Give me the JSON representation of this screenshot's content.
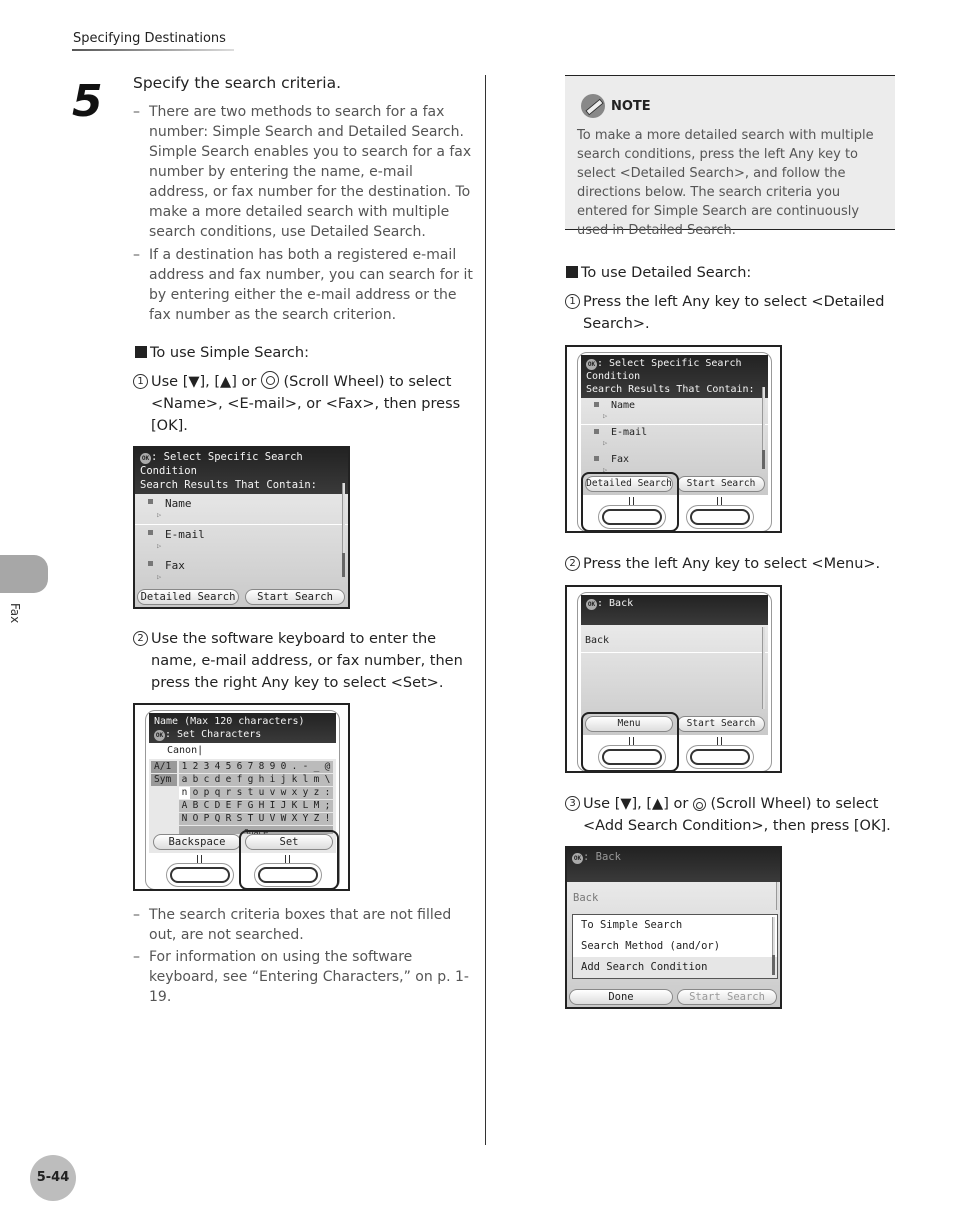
{
  "header": {
    "section_title": "Specifying Destinations"
  },
  "side_tab": {
    "label": "Fax"
  },
  "page_number": "5-44",
  "step": {
    "number": "5",
    "title": "Specify the search criteria.",
    "bullets": [
      "There are two methods to search for a fax number: Simple Search and Detailed Search. Simple Search enables you to search for a fax number by entering the name, e-mail address, or fax number for the destination. To make a more detailed search with multiple search conditions, use Detailed Search.",
      "If a destination has both a registered e-mail address and fax number, you can search for it by entering either the e-mail address or the fax number as the search criterion."
    ]
  },
  "simple_search": {
    "heading": "To use Simple Search:",
    "step1": {
      "num": "1",
      "pre": "Use [▼], [▲] or",
      "post": "(Scroll Wheel) to select <Name>, <E-mail>, or <Fax>, then press [OK]."
    },
    "step2": {
      "num": "2",
      "text": "Use the software keyboard to enter the name, e-mail address, or fax number, then press the right Any key to select <Set>."
    },
    "notes": [
      "The search criteria boxes that are not filled out, are not searched.",
      "For information on using the software keyboard, see “Entering Characters,” on p. 1-19."
    ]
  },
  "screen_simple": {
    "header_line1": ": Select Specific Search Condition",
    "header_line2": "Search Results That Contain:",
    "ok_label": "OK",
    "items": [
      "Name",
      "E-mail",
      "Fax"
    ],
    "left_button": "Detailed Search",
    "right_button": "Start Search"
  },
  "screen_keyboard": {
    "header_line1": "Name (Max 120 characters)",
    "header_line2": ": Set Characters",
    "ok_label": "OK",
    "input_value": "Canon",
    "modes": [
      "A/1",
      "Sym"
    ],
    "rows": [
      [
        "1",
        "2",
        "3",
        "4",
        "5",
        "6",
        "7",
        "8",
        "9",
        "0",
        ".",
        "-",
        "_",
        "@"
      ],
      [
        "a",
        "b",
        "c",
        "d",
        "e",
        "f",
        "g",
        "h",
        "i",
        "j",
        "k",
        "l",
        "m",
        "\\"
      ],
      [
        "n",
        "o",
        "p",
        "q",
        "r",
        "s",
        "t",
        "u",
        "v",
        "w",
        "x",
        "y",
        "z",
        ":"
      ],
      [
        "A",
        "B",
        "C",
        "D",
        "E",
        "F",
        "G",
        "H",
        "I",
        "J",
        "K",
        "L",
        "M",
        ";"
      ],
      [
        "N",
        "O",
        "P",
        "Q",
        "R",
        "S",
        "T",
        "U",
        "V",
        "W",
        "X",
        "Y",
        "Z",
        "!"
      ]
    ],
    "space_label": "Space",
    "left_button": "Backspace",
    "right_button": "Set"
  },
  "note": {
    "label": "NOTE",
    "text": "To make a more detailed search with multiple search conditions, press the left Any key to select <Detailed Search>, and follow the directions below. The search criteria you entered for Simple Search are continuously used in Detailed Search."
  },
  "detailed_search": {
    "heading": "To use Detailed Search:",
    "step1": {
      "num": "1",
      "text": "Press the left Any key to select <Detailed Search>."
    },
    "step2": {
      "num": "2",
      "text": "Press the left Any key to select <Menu>."
    },
    "step3": {
      "num": "3",
      "pre": "Use [▼], [▲] or",
      "post": "(Scroll Wheel) to select <Add Search Condition>, then press [OK]."
    }
  },
  "screen_detailed1": {
    "header_line1": ": Select Specific Search Condition",
    "header_line2": "Search Results That Contain:",
    "ok_label": "OK",
    "items": [
      "Name",
      "E-mail",
      "Fax"
    ],
    "left_button": "Detailed Search",
    "right_button": "Start Search"
  },
  "screen_menu": {
    "header_line1": ": Back",
    "ok_label": "OK",
    "item": "Back",
    "left_button": "Menu",
    "right_button": "Start Search"
  },
  "screen_add": {
    "header_line1": ": Back",
    "ok_label": "OK",
    "item": "Back",
    "menu_items": [
      "To Simple Search",
      "Search Method (and/or)",
      "Add Search Condition"
    ],
    "selected_index": 2,
    "left_button": "Done",
    "right_button": "Start Search"
  }
}
